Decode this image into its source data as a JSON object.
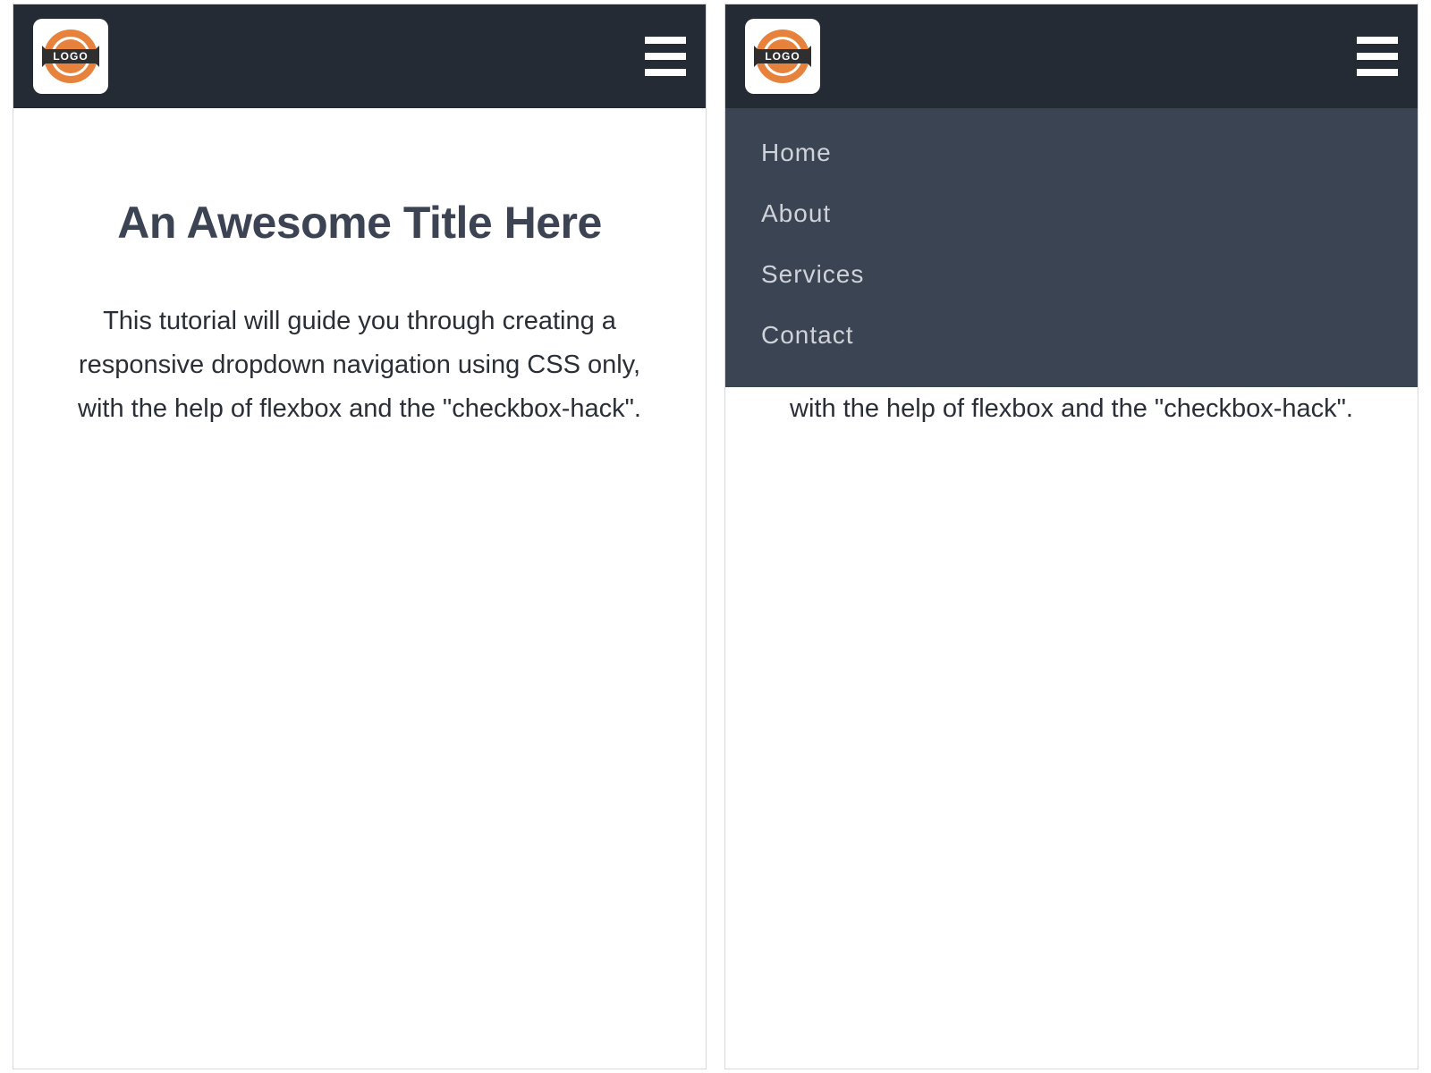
{
  "logo_text": "LOGO",
  "article": {
    "title": "An Awesome Title Here",
    "description": "This tutorial will guide you through creating a responsive dropdown navigation using CSS only, with the help of flexbox and the \"checkbox-hack\"."
  },
  "menu": {
    "items": [
      {
        "label": "Home"
      },
      {
        "label": "About"
      },
      {
        "label": "Services"
      },
      {
        "label": "Contact"
      }
    ]
  },
  "colors": {
    "header_bg": "#252b35",
    "menu_bg": "#3b4452",
    "logo_orange": "#e7823c",
    "logo_banner": "#2f2f2f"
  }
}
